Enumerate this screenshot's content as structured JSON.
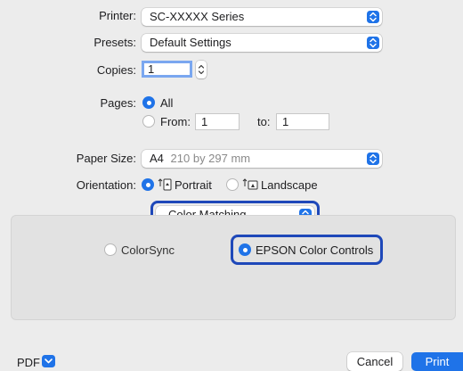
{
  "printer": {
    "label": "Printer:",
    "value": "SC-XXXXX Series"
  },
  "presets": {
    "label": "Presets:",
    "value": "Default Settings"
  },
  "copies": {
    "label": "Copies:",
    "value": "1"
  },
  "pages": {
    "label": "Pages:",
    "all_label": "All",
    "from_label": "From:",
    "from_value": "1",
    "to_label": "to:",
    "to_value": "1"
  },
  "paper_size": {
    "label": "Paper Size:",
    "value": "A4",
    "detail": "210 by 297 mm"
  },
  "orientation": {
    "label": "Orientation:",
    "portrait": "Portrait",
    "landscape": "Landscape"
  },
  "section_popup": {
    "value": "Color Matching"
  },
  "color_matching": {
    "colorsync": "ColorSync",
    "epson": "EPSON Color Controls"
  },
  "footer": {
    "pdf": "PDF",
    "cancel": "Cancel",
    "print": "Print"
  },
  "colors": {
    "accent": "#1f73e8",
    "highlight": "#1e48b9"
  }
}
